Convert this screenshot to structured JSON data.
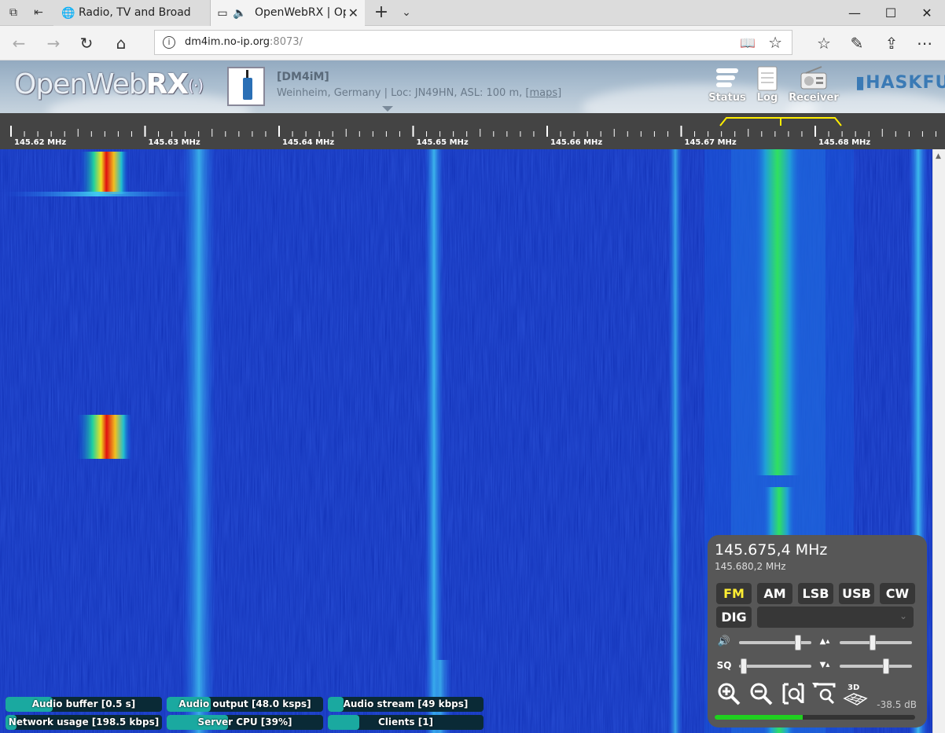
{
  "browser": {
    "tabs": [
      {
        "label": "Radio, TV and Broadcasting",
        "active": false
      },
      {
        "label": "OpenWebRX | OpenWebRX",
        "active": true
      }
    ],
    "address": {
      "host": "dm4im.no-ip.org",
      "port": ":8073/"
    }
  },
  "header": {
    "logo": {
      "open": "Open",
      "web": "Web",
      "rx": "RX"
    },
    "callsign": "[DM4iM]",
    "location": "Weinheim, Germany | Loc: JN49HN, ASL: 100 m,",
    "maps_link": "[maps]",
    "buttons": [
      {
        "label": "Status",
        "icon": "status-icon"
      },
      {
        "label": "Log",
        "icon": "log-icon"
      },
      {
        "label": "Receiver",
        "icon": "receiver-icon"
      }
    ],
    "sponsor": "HASKFU"
  },
  "scale": {
    "labels": [
      "145.62 MHz",
      "145.63 MHz",
      "145.64 MHz",
      "145.65 MHz",
      "145.66 MHz",
      "145.67 MHz",
      "145.68 MHz"
    ]
  },
  "status_bars": [
    {
      "label": "Audio buffer [0.5 s]",
      "level": 0.3
    },
    {
      "label": "Audio output [48.0 ksps]",
      "level": 0.28
    },
    {
      "label": "Audio stream [49 kbps]",
      "level": 0.1
    },
    {
      "label": "Network usage [198.5 kbps]",
      "level": 0.07
    },
    {
      "label": "Server CPU [39%]",
      "level": 0.39
    },
    {
      "label": "Clients [1]",
      "level": 0.2
    }
  ],
  "receiver": {
    "frequency": "145.675,4 MHz",
    "frequency_secondary": "145.680,2 MHz",
    "modes": [
      "FM",
      "AM",
      "LSB",
      "USB",
      "CW"
    ],
    "selected_mode": "FM",
    "dig_label": "DIG",
    "sq_label": "SQ",
    "volume": 0.85,
    "squelch": 0.02,
    "waterfall_max": 0.45,
    "waterfall_min": 0.65,
    "db_readout": "-38.5 dB",
    "smeter_level": 0.44,
    "tools": [
      "zoom-in-icon",
      "zoom-out-icon",
      "zoom-out-full-icon",
      "zoom-to-selection-icon",
      "3d-spectrum-icon"
    ]
  },
  "colors": {
    "waterfall_bg": "#0f2fb5",
    "signal_hot": "#e01010",
    "signal_green": "#30e060",
    "passband": "#ffee00",
    "active_mode": "#ffee33",
    "meter": "#20d020"
  }
}
